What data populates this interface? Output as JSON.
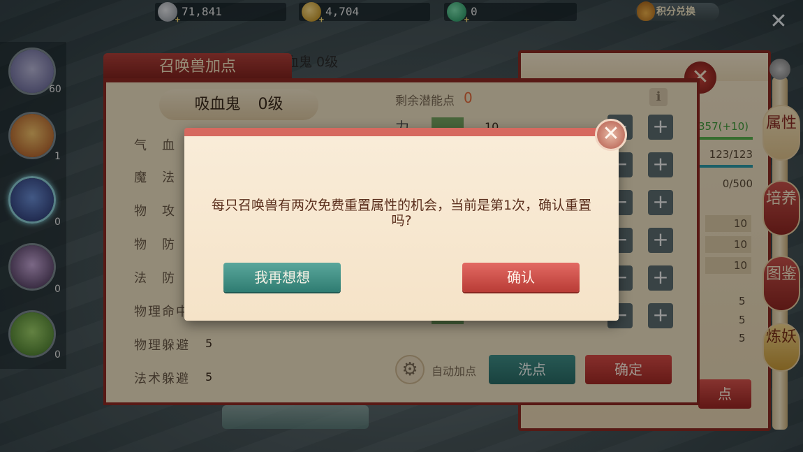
{
  "currency": {
    "silver": "71,841",
    "gold": "4,704",
    "jade": "0",
    "points_shop_label": "积分兑换"
  },
  "pets": [
    {
      "level": "60"
    },
    {
      "level": "1"
    },
    {
      "level": "0"
    },
    {
      "level": "0"
    },
    {
      "level": "0"
    }
  ],
  "main_panel": {
    "title": "召唤兽加点",
    "background_title": "吸血鬼 0级",
    "pet_name": "吸血鬼",
    "pet_level": "0级",
    "attributes": [
      {
        "label": "气　血",
        "value": ""
      },
      {
        "label": "魔　法",
        "value": ""
      },
      {
        "label": "物　攻",
        "value": ""
      },
      {
        "label": "物　防",
        "value": ""
      },
      {
        "label": "法　防",
        "value": ""
      },
      {
        "label": "物理命中",
        "value": ""
      },
      {
        "label": "物理躲避",
        "value": "5"
      },
      {
        "label": "法术躲避",
        "value": "5"
      }
    ],
    "remaining_label": "剩余潜能点",
    "remaining_value": "0",
    "potential_first_label": "力",
    "potential_first_value": "10",
    "auto_add_label": "自动加点",
    "wash_label": "洗点",
    "confirm_label": "确定"
  },
  "right_panel": {
    "hp": "357(+10)",
    "mp": "123/123",
    "exp": "0/500",
    "numbers": [
      "10",
      "10",
      "10"
    ],
    "small_values": [
      "5",
      "5",
      "5"
    ],
    "add_button_label": "点",
    "tabs": {
      "attr": "属性",
      "train": "培养",
      "atlas": "图鉴",
      "refine": "炼妖"
    }
  },
  "modal": {
    "message": "每只召唤兽有两次免费重置属性的机会，当前是第1次，确认重置吗?",
    "cancel_label": "我再想想",
    "ok_label": "确认"
  },
  "colors": {
    "primary_red": "#8f2923",
    "teal_button": "#2f7c72",
    "red_button": "#b93c36",
    "parchment": "#f5e3c8"
  }
}
